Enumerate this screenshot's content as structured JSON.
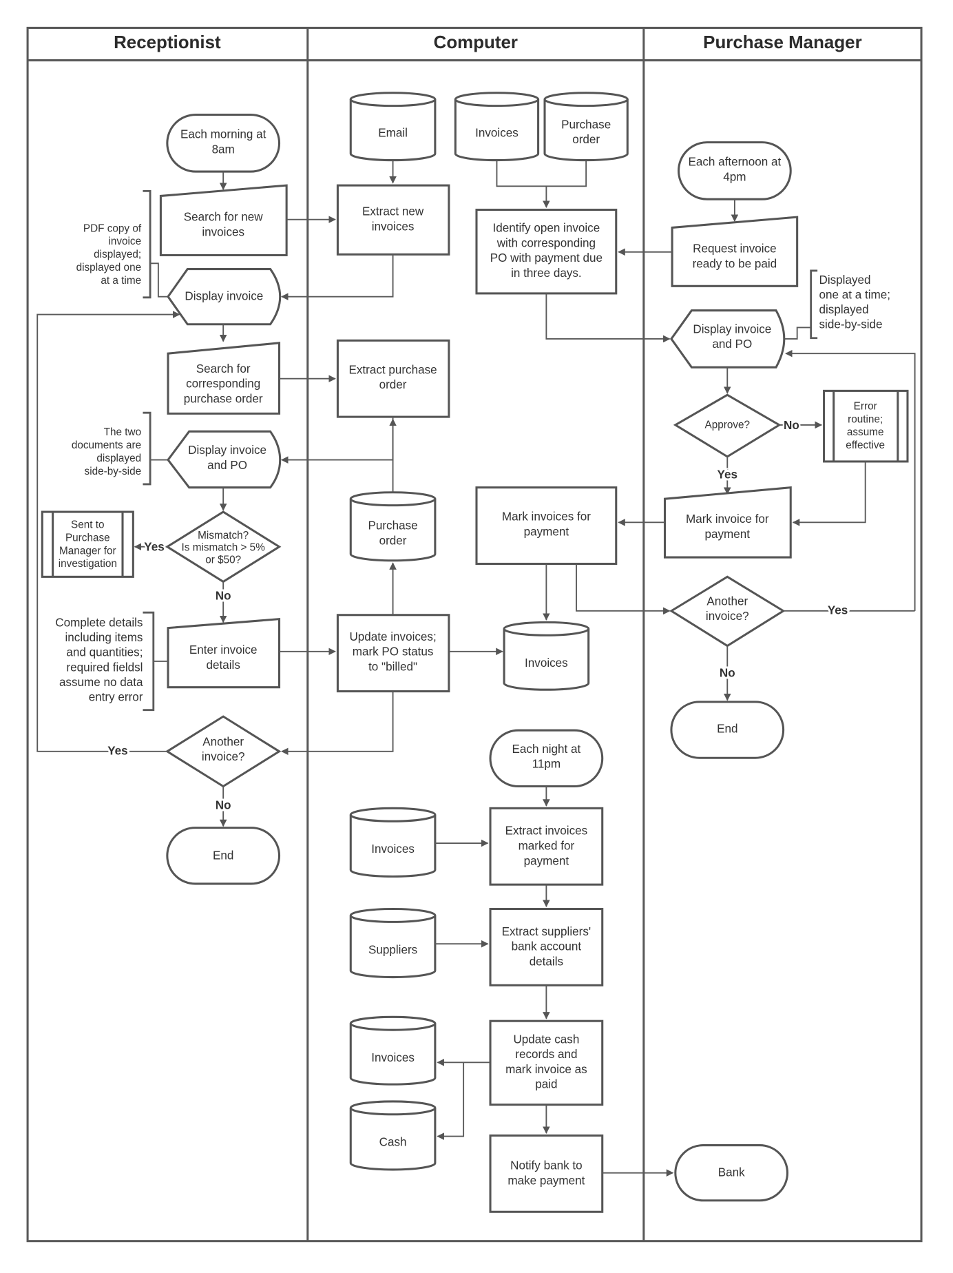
{
  "lanes": [
    {
      "title": "Receptionist"
    },
    {
      "title": "Computer"
    },
    {
      "title": "Purchase Manager"
    }
  ],
  "receptionist": {
    "start": [
      "Each morning at",
      "8am"
    ],
    "search_new": [
      "Search for new",
      "invoices"
    ],
    "note_pdf": [
      "PDF copy of",
      "invoice",
      "displayed;",
      "displayed one",
      "at a time"
    ],
    "display_invoice": [
      "Display invoice"
    ],
    "search_po": [
      "Search for",
      "corresponding",
      "purchase order"
    ],
    "note_two_docs": [
      "The two",
      "documents are",
      "displayed",
      "side-by-side"
    ],
    "display_invoice_po": [
      "Display invoice",
      "and PO"
    ],
    "mismatch": [
      "Mismatch?",
      "Is mismatch > 5%",
      "or $50?"
    ],
    "sent_to_pm": [
      "Sent to",
      "Purchase",
      "Manager for",
      "investigation"
    ],
    "enter_details": [
      "Enter invoice",
      "details"
    ],
    "note_details": [
      "Complete details",
      "including items",
      "and quantities;",
      "required fieldsl",
      "assume no  data",
      "entry error"
    ],
    "another": [
      "Another",
      "invoice?"
    ],
    "end": [
      "End"
    ],
    "yes": "Yes",
    "no": "No"
  },
  "computer": {
    "email_db": [
      "Email"
    ],
    "invoices_db_top": [
      "Invoices"
    ],
    "po_db_top": [
      "Purchase",
      "order"
    ],
    "extract_new": [
      "Extract new",
      "invoices"
    ],
    "identify_open": [
      "Identify open invoice",
      "with corresponding",
      "PO with payment due",
      "in three days."
    ],
    "extract_po": [
      "Extract purchase",
      "order"
    ],
    "po_db_mid": [
      "Purchase",
      "order"
    ],
    "mark_invoices": [
      "Mark invoices for",
      "payment"
    ],
    "update_invoices": [
      "Update invoices;",
      "mark PO status",
      "to \"billed\""
    ],
    "invoices_db_mid": [
      "Invoices"
    ],
    "night_start": [
      "Each night at",
      "11pm"
    ],
    "invoices_db_night": [
      "Invoices"
    ],
    "extract_marked": [
      "Extract invoices",
      "marked for",
      "payment"
    ],
    "suppliers_db": [
      "Suppliers"
    ],
    "extract_bank": [
      "Extract suppliers'",
      "bank account",
      "details"
    ],
    "invoices_db_bottom": [
      "Invoices"
    ],
    "update_cash": [
      "Update cash",
      "records and",
      "mark invoice as",
      "paid"
    ],
    "cash_db": [
      "Cash"
    ],
    "notify_bank": [
      "Notify bank to",
      "make payment"
    ]
  },
  "purchase_manager": {
    "start": [
      "Each afternoon at",
      "4pm"
    ],
    "request": [
      "Request invoice",
      "ready to be paid"
    ],
    "note_display": [
      "Displayed",
      "one at a time;",
      "displayed",
      "side-by-side"
    ],
    "display_invoice_po": [
      "Display invoice",
      "and PO"
    ],
    "approve": [
      "Approve?"
    ],
    "error_routine": [
      "Error",
      "routine;",
      "assume",
      "effective"
    ],
    "mark_invoice": [
      "Mark invoice for",
      "payment"
    ],
    "another": [
      "Another",
      "invoice?"
    ],
    "end": [
      "End"
    ],
    "bank": [
      "Bank"
    ],
    "yes": "Yes",
    "no": "No"
  }
}
